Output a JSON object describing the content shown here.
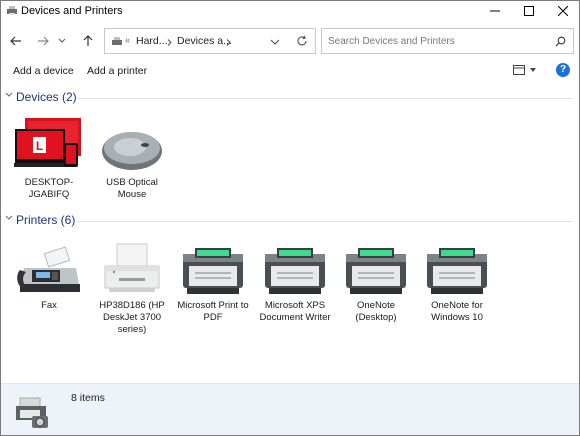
{
  "window": {
    "title": "Devices and Printers"
  },
  "nav": {
    "overflow": "«",
    "breadcrumbs": [
      "Hard...",
      "Devices a..."
    ],
    "search_placeholder": "Search Devices and Printers"
  },
  "commands": {
    "add_device": "Add a device",
    "add_printer": "Add a printer"
  },
  "groups": {
    "devices": {
      "label": "Devices (2)",
      "items": [
        {
          "label": "DESKTOP-JGABIFQ",
          "icon": "laptop-monitor-icon"
        },
        {
          "label": "USB Optical Mouse",
          "icon": "mouse-icon"
        }
      ]
    },
    "printers": {
      "label": "Printers (6)",
      "items": [
        {
          "label": "Fax",
          "icon": "fax-icon"
        },
        {
          "label": "HP38D186 (HP DeskJet 3700 series)",
          "icon": "inkjet-printer-icon"
        },
        {
          "label": "Microsoft Print to PDF",
          "icon": "printer-icon"
        },
        {
          "label": "Microsoft XPS Document Writer",
          "icon": "printer-icon"
        },
        {
          "label": "OneNote (Desktop)",
          "icon": "printer-icon"
        },
        {
          "label": "OneNote for Windows 10",
          "icon": "printer-icon"
        }
      ]
    }
  },
  "status": {
    "count": "8 items"
  },
  "colors": {
    "group_header": "#1e3287",
    "help": "#1a73d9",
    "status_bg": "#eef2f9",
    "brand_red": "#d9101d",
    "printer_green": "#3cdc8c"
  }
}
